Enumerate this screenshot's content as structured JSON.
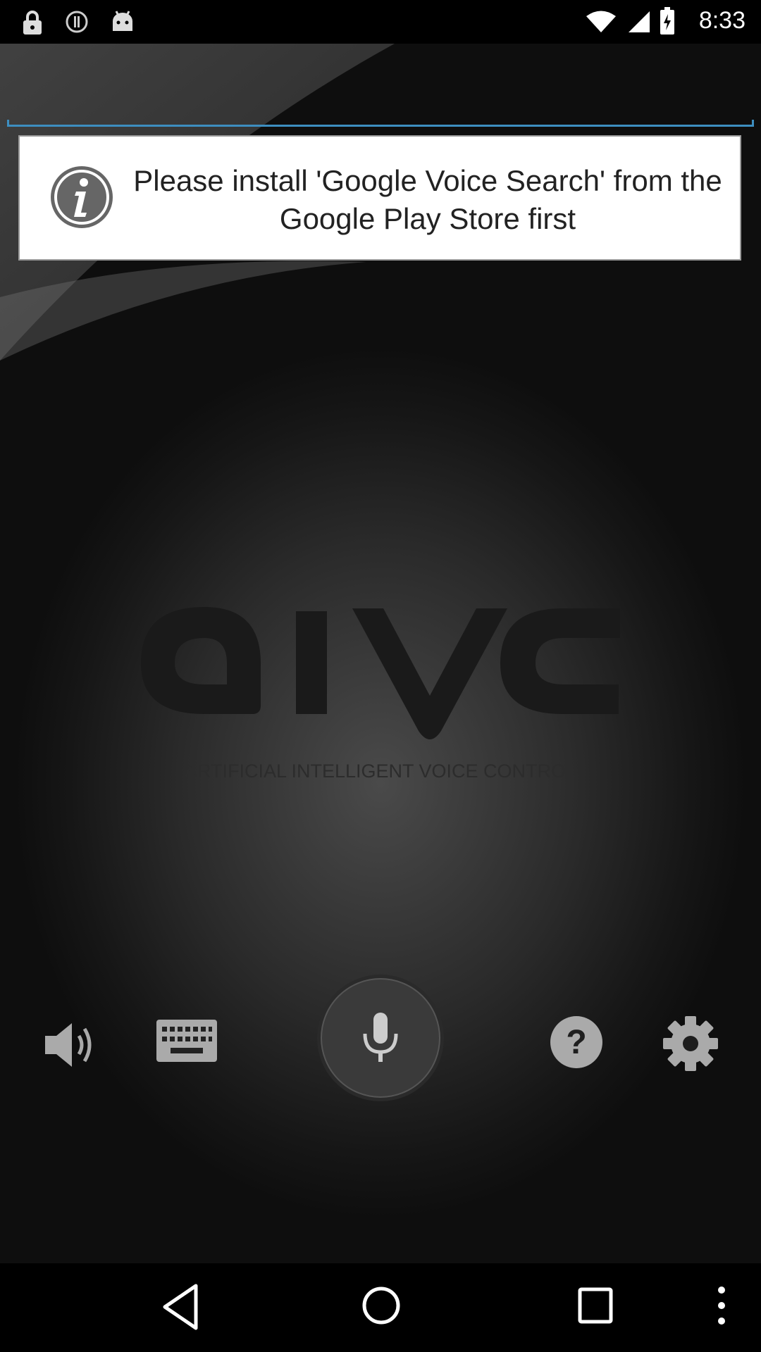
{
  "status_bar": {
    "time": "8:33",
    "icons": [
      "lock-icon",
      "sync-icon",
      "android-icon",
      "wifi-icon",
      "signal-icon",
      "battery-icon"
    ]
  },
  "toast": {
    "message": "Please install 'Google Voice Search' from the Google Play Store first",
    "icon": "info-icon"
  },
  "logo": {
    "wordmark": "aivc",
    "tagline": "ARTIFICIAL INTELLIGENT VOICE CONTROL"
  },
  "controls": [
    "volume-icon",
    "keyboard-icon",
    "microphone-icon",
    "help-icon",
    "settings-icon"
  ],
  "nav_bar": [
    "back-icon",
    "home-icon",
    "recents-icon",
    "more-options-icon"
  ],
  "colors": {
    "accent_line": "#3d8ec0",
    "toast_background": "#ffffff"
  }
}
